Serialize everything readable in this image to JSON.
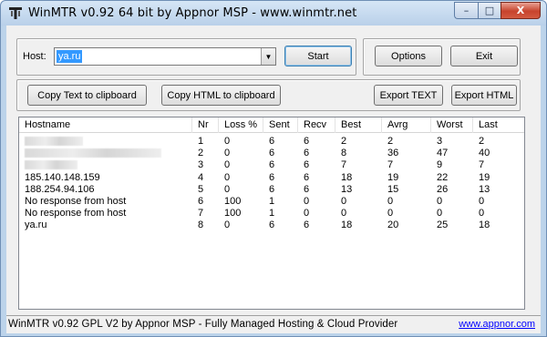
{
  "window": {
    "title": "WinMTR v0.92 64 bit by Appnor MSP - www.winmtr.net",
    "caption": {
      "minimize": "–",
      "maximize": "□",
      "close": "X"
    }
  },
  "host": {
    "label": "Host:",
    "value": "ya.ru",
    "dropdown_icon": "▼"
  },
  "buttons": {
    "start": "Start",
    "options": "Options",
    "exit": "Exit",
    "copy_text": "Copy Text to clipboard",
    "copy_html": "Copy HTML to clipboard",
    "export_text": "Export TEXT",
    "export_html": "Export HTML"
  },
  "table": {
    "columns": [
      "Hostname",
      "Nr",
      "Loss %",
      "Sent",
      "Recv",
      "Best",
      "Avrg",
      "Worst",
      "Last"
    ],
    "rows": [
      {
        "hostname": "",
        "hostname_obscured": true,
        "nr": "1",
        "loss": "0",
        "sent": "6",
        "recv": "6",
        "best": "2",
        "avrg": "2",
        "worst": "3",
        "last": "2"
      },
      {
        "hostname": "",
        "hostname_obscured": true,
        "nr": "2",
        "loss": "0",
        "sent": "6",
        "recv": "6",
        "best": "8",
        "avrg": "36",
        "worst": "47",
        "last": "40"
      },
      {
        "hostname": "",
        "hostname_obscured": true,
        "nr": "3",
        "loss": "0",
        "sent": "6",
        "recv": "6",
        "best": "7",
        "avrg": "7",
        "worst": "9",
        "last": "7"
      },
      {
        "hostname": "185.140.148.159",
        "hostname_obscured": false,
        "nr": "4",
        "loss": "0",
        "sent": "6",
        "recv": "6",
        "best": "18",
        "avrg": "19",
        "worst": "22",
        "last": "19"
      },
      {
        "hostname": "188.254.94.106",
        "hostname_obscured": false,
        "nr": "5",
        "loss": "0",
        "sent": "6",
        "recv": "6",
        "best": "13",
        "avrg": "15",
        "worst": "26",
        "last": "13"
      },
      {
        "hostname": "No response from host",
        "hostname_obscured": false,
        "nr": "6",
        "loss": "100",
        "sent": "1",
        "recv": "0",
        "best": "0",
        "avrg": "0",
        "worst": "0",
        "last": "0"
      },
      {
        "hostname": "No response from host",
        "hostname_obscured": false,
        "nr": "7",
        "loss": "100",
        "sent": "1",
        "recv": "0",
        "best": "0",
        "avrg": "0",
        "worst": "0",
        "last": "0"
      },
      {
        "hostname": "ya.ru",
        "hostname_obscured": false,
        "nr": "8",
        "loss": "0",
        "sent": "6",
        "recv": "6",
        "best": "18",
        "avrg": "20",
        "worst": "25",
        "last": "18"
      }
    ]
  },
  "status": {
    "text": "WinMTR v0.92 GPL V2 by Appnor MSP - Fully Managed Hosting & Cloud Provider",
    "link": "www.appnor.com"
  },
  "colors": {
    "title_bar": "#b9d0e9",
    "selection": "#3399ff",
    "link": "#0000ff",
    "close_button": "#c7432d"
  }
}
